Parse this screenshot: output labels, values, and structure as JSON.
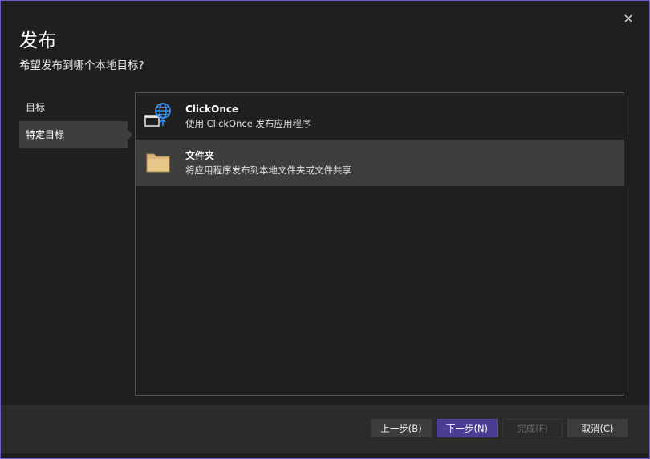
{
  "dialog": {
    "title": "发布",
    "subtitle": "希望发布到哪个本地目标?",
    "close_icon": "close-icon"
  },
  "nav": {
    "items": [
      {
        "label": "目标",
        "selected": false
      },
      {
        "label": "特定目标",
        "selected": true
      }
    ]
  },
  "options": [
    {
      "title": "ClickOnce",
      "description": "使用 ClickOnce 发布应用程序",
      "icon": "globe-window-icon",
      "selected": false
    },
    {
      "title": "文件夹",
      "description": "将应用程序发布到本地文件夹或文件共享",
      "icon": "folder-icon",
      "selected": true
    }
  ],
  "footer": {
    "back_label": "上一步(B)",
    "next_label": "下一步(N)",
    "finish_label": "完成(F)",
    "cancel_label": "取消(C)"
  },
  "colors": {
    "accent": "#4b3b92",
    "border": "#6a5acd",
    "background": "#1f1f1f",
    "selected": "#3d3d3d",
    "globe": "#3b8eea",
    "folder": "#dcb67a"
  }
}
